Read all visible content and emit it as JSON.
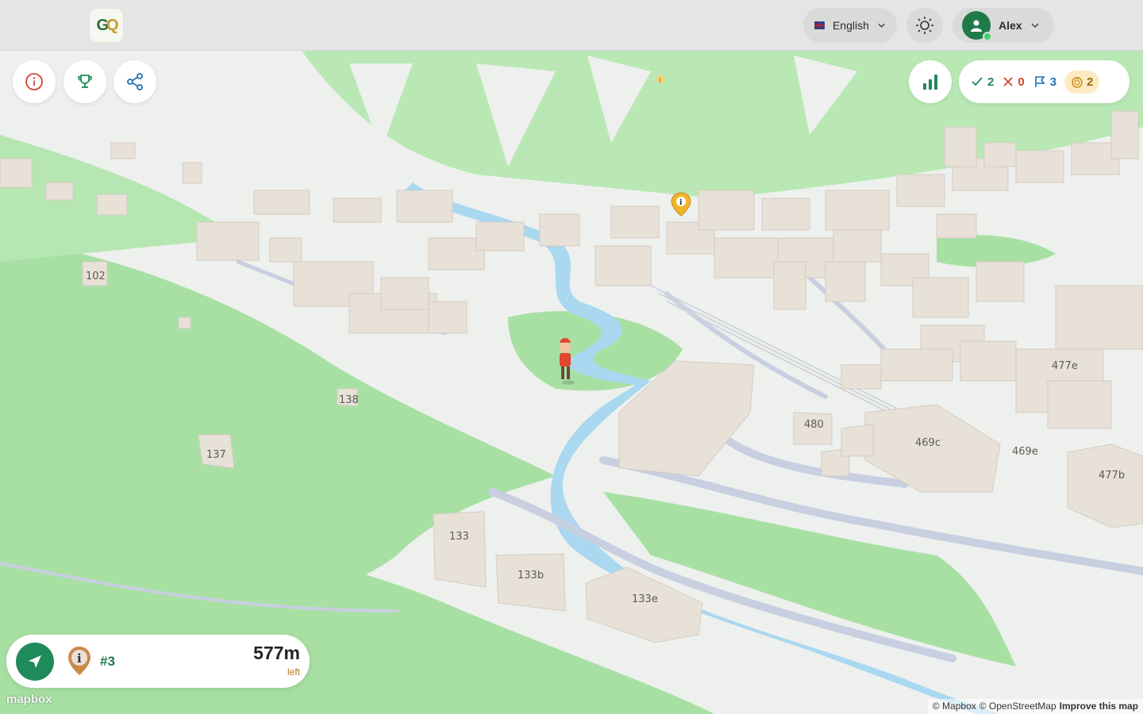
{
  "header": {
    "logo_text_a": "G",
    "logo_text_b": "Q",
    "language_label": "English",
    "user_name": "Alex"
  },
  "score": {
    "correct": "2",
    "wrong": "0",
    "flags": "3",
    "coins": "2"
  },
  "navigation": {
    "target_number": "#3",
    "distance": "577m",
    "distance_suffix": "left"
  },
  "map_labels": {
    "b102": "102",
    "b138": "138",
    "b137": "137",
    "b133": "133",
    "b133b": "133b",
    "b133e": "133e",
    "b480": "480",
    "b469c": "469c",
    "b469e": "469e",
    "b477e": "477e",
    "b477b": "477b"
  },
  "attribution": {
    "mapbox_logo": "mapbox",
    "mapbox": "© Mapbox",
    "osm": "© OpenStreetMap",
    "improve": "Improve this map"
  },
  "colors": {
    "accent": "#1f8a5a",
    "correct": "#1f8a5a",
    "wrong": "#d2472e",
    "flag": "#1f6fb0",
    "coin": "#c98a1a",
    "grass": "#a8e0a4",
    "river": "#a9d8f0",
    "building": "#e8e1d8"
  },
  "icons": [
    "info-icon",
    "trophy-icon",
    "share-icon",
    "bar-chart-icon",
    "check-icon",
    "close-icon",
    "flag-icon",
    "coin-icon",
    "sun-icon",
    "chevron-down-icon",
    "navigation-arrow-icon",
    "info-pin-icon",
    "user-icon"
  ]
}
